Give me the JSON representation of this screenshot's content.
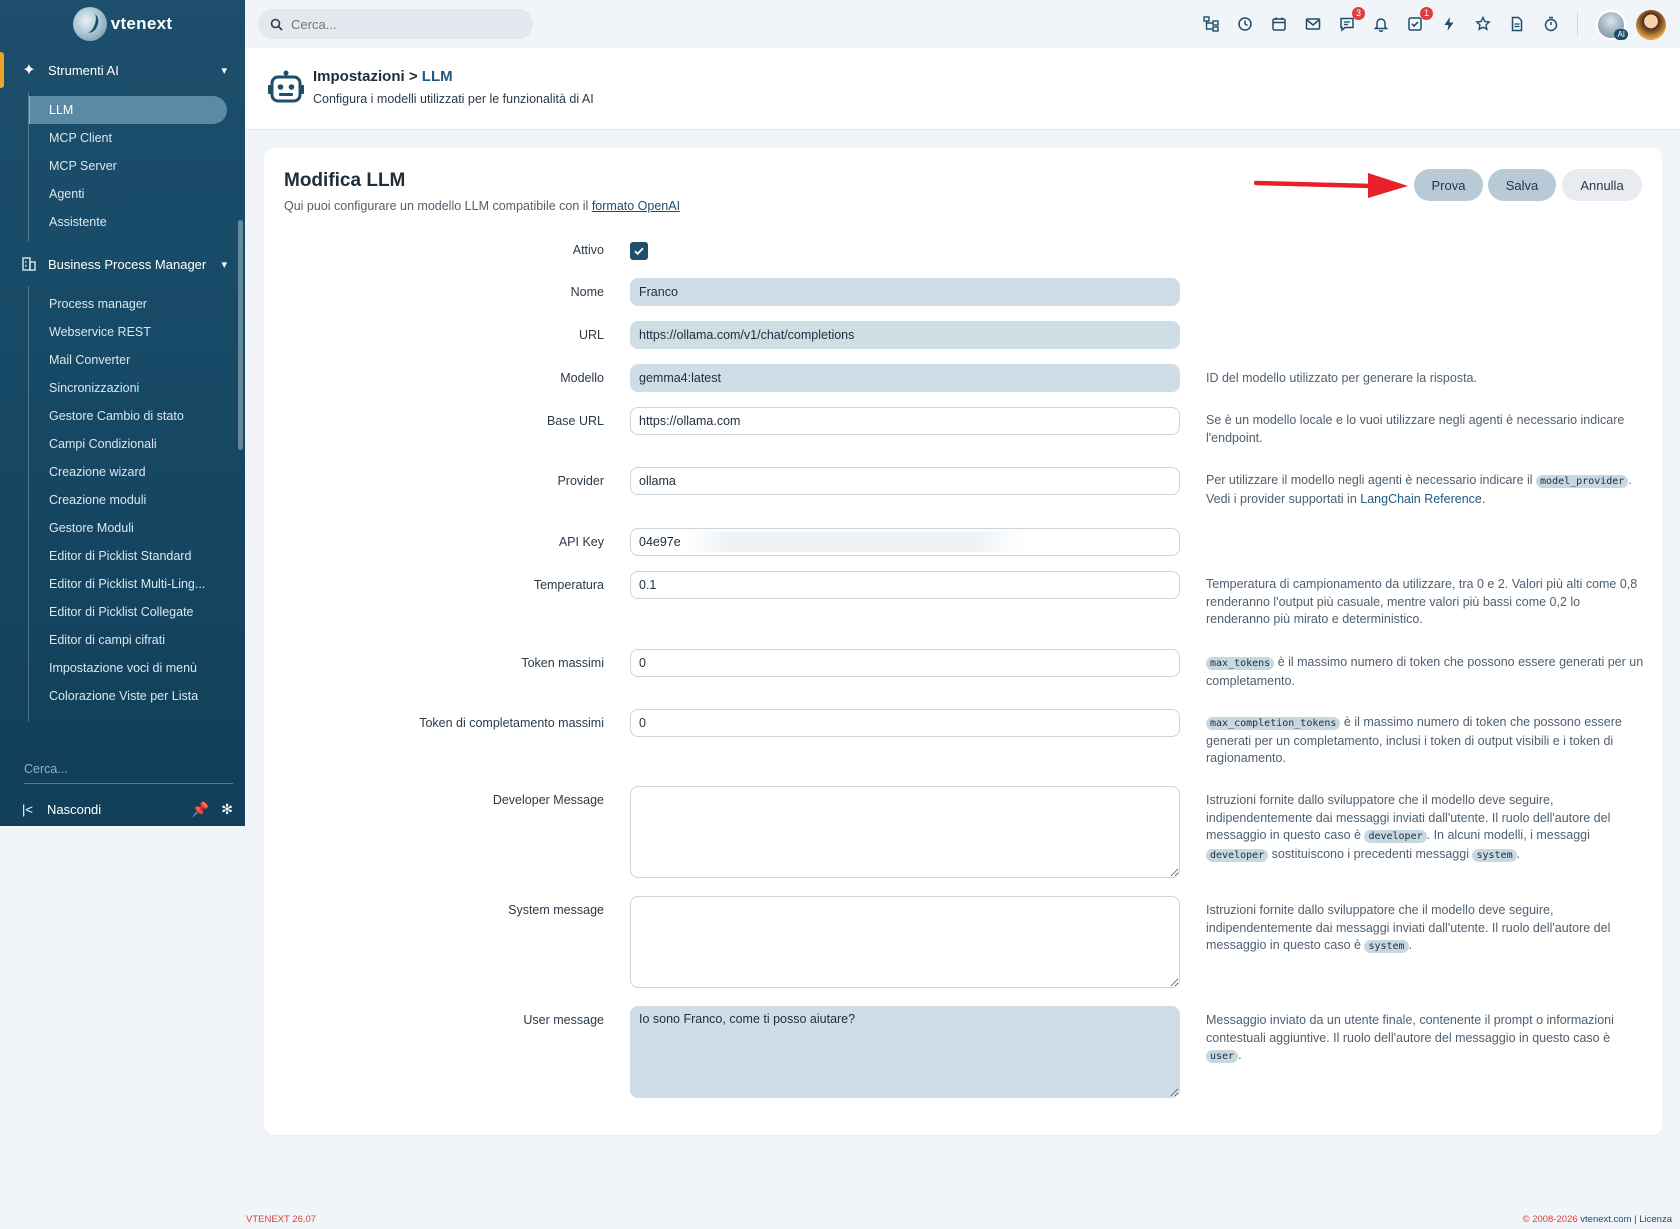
{
  "brand": {
    "name": "vtenext"
  },
  "sidebar": {
    "section_ai": "Strumenti AI",
    "ai_items": [
      "LLM",
      "MCP Client",
      "MCP Server",
      "Agenti",
      "Assistente"
    ],
    "section_bpm": "Business Process Manager",
    "bpm_items": [
      "Process manager",
      "Webservice REST",
      "Mail Converter",
      "Sincronizzazioni",
      "Gestore Cambio di stato",
      "Campi Condizionali",
      "Creazione wizard",
      "Creazione moduli",
      "Gestore Moduli",
      "Editor di Picklist Standard",
      "Editor di Picklist Multi-Ling...",
      "Editor di Picklist Collegate",
      "Editor di campi cifrati",
      "Impostazione voci di menù",
      "Colorazione Viste per Lista"
    ],
    "search_placeholder": "Cerca...",
    "hide_label": "Nascondi"
  },
  "topbar": {
    "search_placeholder": "Cerca...",
    "badges": {
      "chat": "3",
      "tasks": "1"
    },
    "ai_badge": "AI"
  },
  "header": {
    "crumb_parent": "Impostazioni >",
    "crumb_current": "LLM",
    "subtitle": "Configura i modelli utilizzati per le funzionalità di AI"
  },
  "card": {
    "title": "Modifica LLM",
    "subtitle_prefix": "Qui puoi configurare un modello LLM compatibile con il ",
    "subtitle_link": "formato OpenAI",
    "buttons": {
      "test": "Prova",
      "save": "Salva",
      "cancel": "Annulla"
    }
  },
  "form": {
    "active_label": "Attivo",
    "name_label": "Nome",
    "name_value": "Franco",
    "url_label": "URL",
    "url_value": "https://ollama.com/v1/chat/completions",
    "model_label": "Modello",
    "model_value": "gemma4:latest",
    "model_help": "ID del modello utilizzato per generare la risposta.",
    "baseurl_label": "Base URL",
    "baseurl_value": "https://ollama.com",
    "baseurl_help": "Se è un modello locale e lo vuoi utilizzare negli agenti è necessario indicare l'endpoint.",
    "provider_label": "Provider",
    "provider_value": "ollama",
    "provider_help_1": "Per utilizzare il modello negli agenti è necessario indicare il ",
    "provider_code": "model_provider",
    "provider_help_2": ". Vedi i provider supportati in ",
    "provider_link": "LangChain Reference",
    "provider_help_3": ".",
    "apikey_label": "API Key",
    "apikey_value": "04e97e",
    "temp_label": "Temperatura",
    "temp_value": "0.1",
    "temp_help": "Temperatura di campionamento da utilizzare, tra 0 e 2. Valori più alti come 0,8 renderanno l'output più casuale, mentre valori più bassi come 0,2 lo renderanno più mirato e deterministico.",
    "maxtok_label": "Token massimi",
    "maxtok_value": "0",
    "maxtok_code": "max_tokens",
    "maxtok_help": " è il massimo numero di token che possono essere generati per un completamento.",
    "maxcomp_label": "Token di completamento massimi",
    "maxcomp_value": "0",
    "maxcomp_code": "max_completion_tokens",
    "maxcomp_help": " è il massimo numero di token che possono essere generati per un completamento, inclusi i token di output visibili e i token di ragionamento.",
    "dev_label": "Developer Message",
    "dev_value": "",
    "dev_help_1": "Istruzioni fornite dallo sviluppatore che il modello deve seguire, indipendentemente dai messaggi inviati dall'utente. Il ruolo dell'autore del messaggio in questo caso è ",
    "dev_code_1": "developer",
    "dev_help_2": ". In alcuni modelli, i messaggi ",
    "dev_code_2": "developer",
    "dev_help_3": " sostituiscono i precedenti messaggi ",
    "dev_code_3": "system",
    "dev_help_4": ".",
    "sys_label": "System message",
    "sys_value": "",
    "sys_help_1": "Istruzioni fornite dallo sviluppatore che il modello deve seguire, indipendentemente dai messaggi inviati dall'utente. Il ruolo dell'autore del messaggio in questo caso è ",
    "sys_code": "system",
    "sys_help_2": ".",
    "user_label": "User message",
    "user_value": "Io sono Franco, come ti posso aiutare?",
    "user_help_1": "Messaggio inviato da un utente finale, contenente il prompt o informazioni contestuali aggiuntive. Il ruolo dell'autore del messaggio in questo caso è ",
    "user_code": "user",
    "user_help_2": "."
  },
  "footer": {
    "version": "VTENEXT 26.07",
    "copyright": "© 2008-2026 ",
    "site": "vtenext.com",
    "license": " | Licenza"
  },
  "colors": {
    "sidebar": "#1d4f6c",
    "accent": "#f0a229",
    "primary": "#1e4e6a",
    "arrow": "#e8202a"
  }
}
